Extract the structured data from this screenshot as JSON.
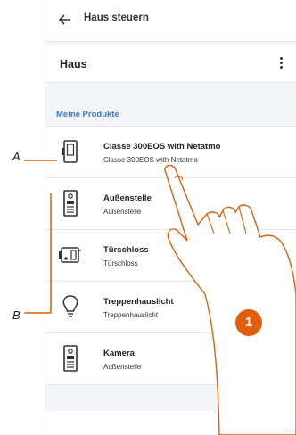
{
  "header": {
    "title": "Haus steuern",
    "back_icon": "arrow-left-icon"
  },
  "house": {
    "title": "Haus",
    "menu_icon": "more-vertical-icon"
  },
  "section": {
    "label": "Meine Produkte"
  },
  "products": [
    {
      "name": "Classe 300EOS with Netatmo",
      "sub": "Classe 300EOS with Netatmo",
      "icon": "video-indoor-unit-icon"
    },
    {
      "name": "Außenstelle",
      "sub": "Außenstelle",
      "icon": "entrance-panel-icon"
    },
    {
      "name": "Türschloss",
      "sub": "Türschloss",
      "icon": "door-lock-icon"
    },
    {
      "name": "Treppenhauslicht",
      "sub": "Treppenhauslicht",
      "icon": "light-bulb-icon"
    },
    {
      "name": "Kamera",
      "sub": "Außenstelle",
      "icon": "camera-entrance-panel-icon"
    }
  ],
  "annotations": {
    "a": "A",
    "b": "B",
    "step": "1",
    "accent_color": "#e35d0c"
  },
  "colors": {
    "link": "#3a78c8",
    "background": "#f4f5f8"
  }
}
